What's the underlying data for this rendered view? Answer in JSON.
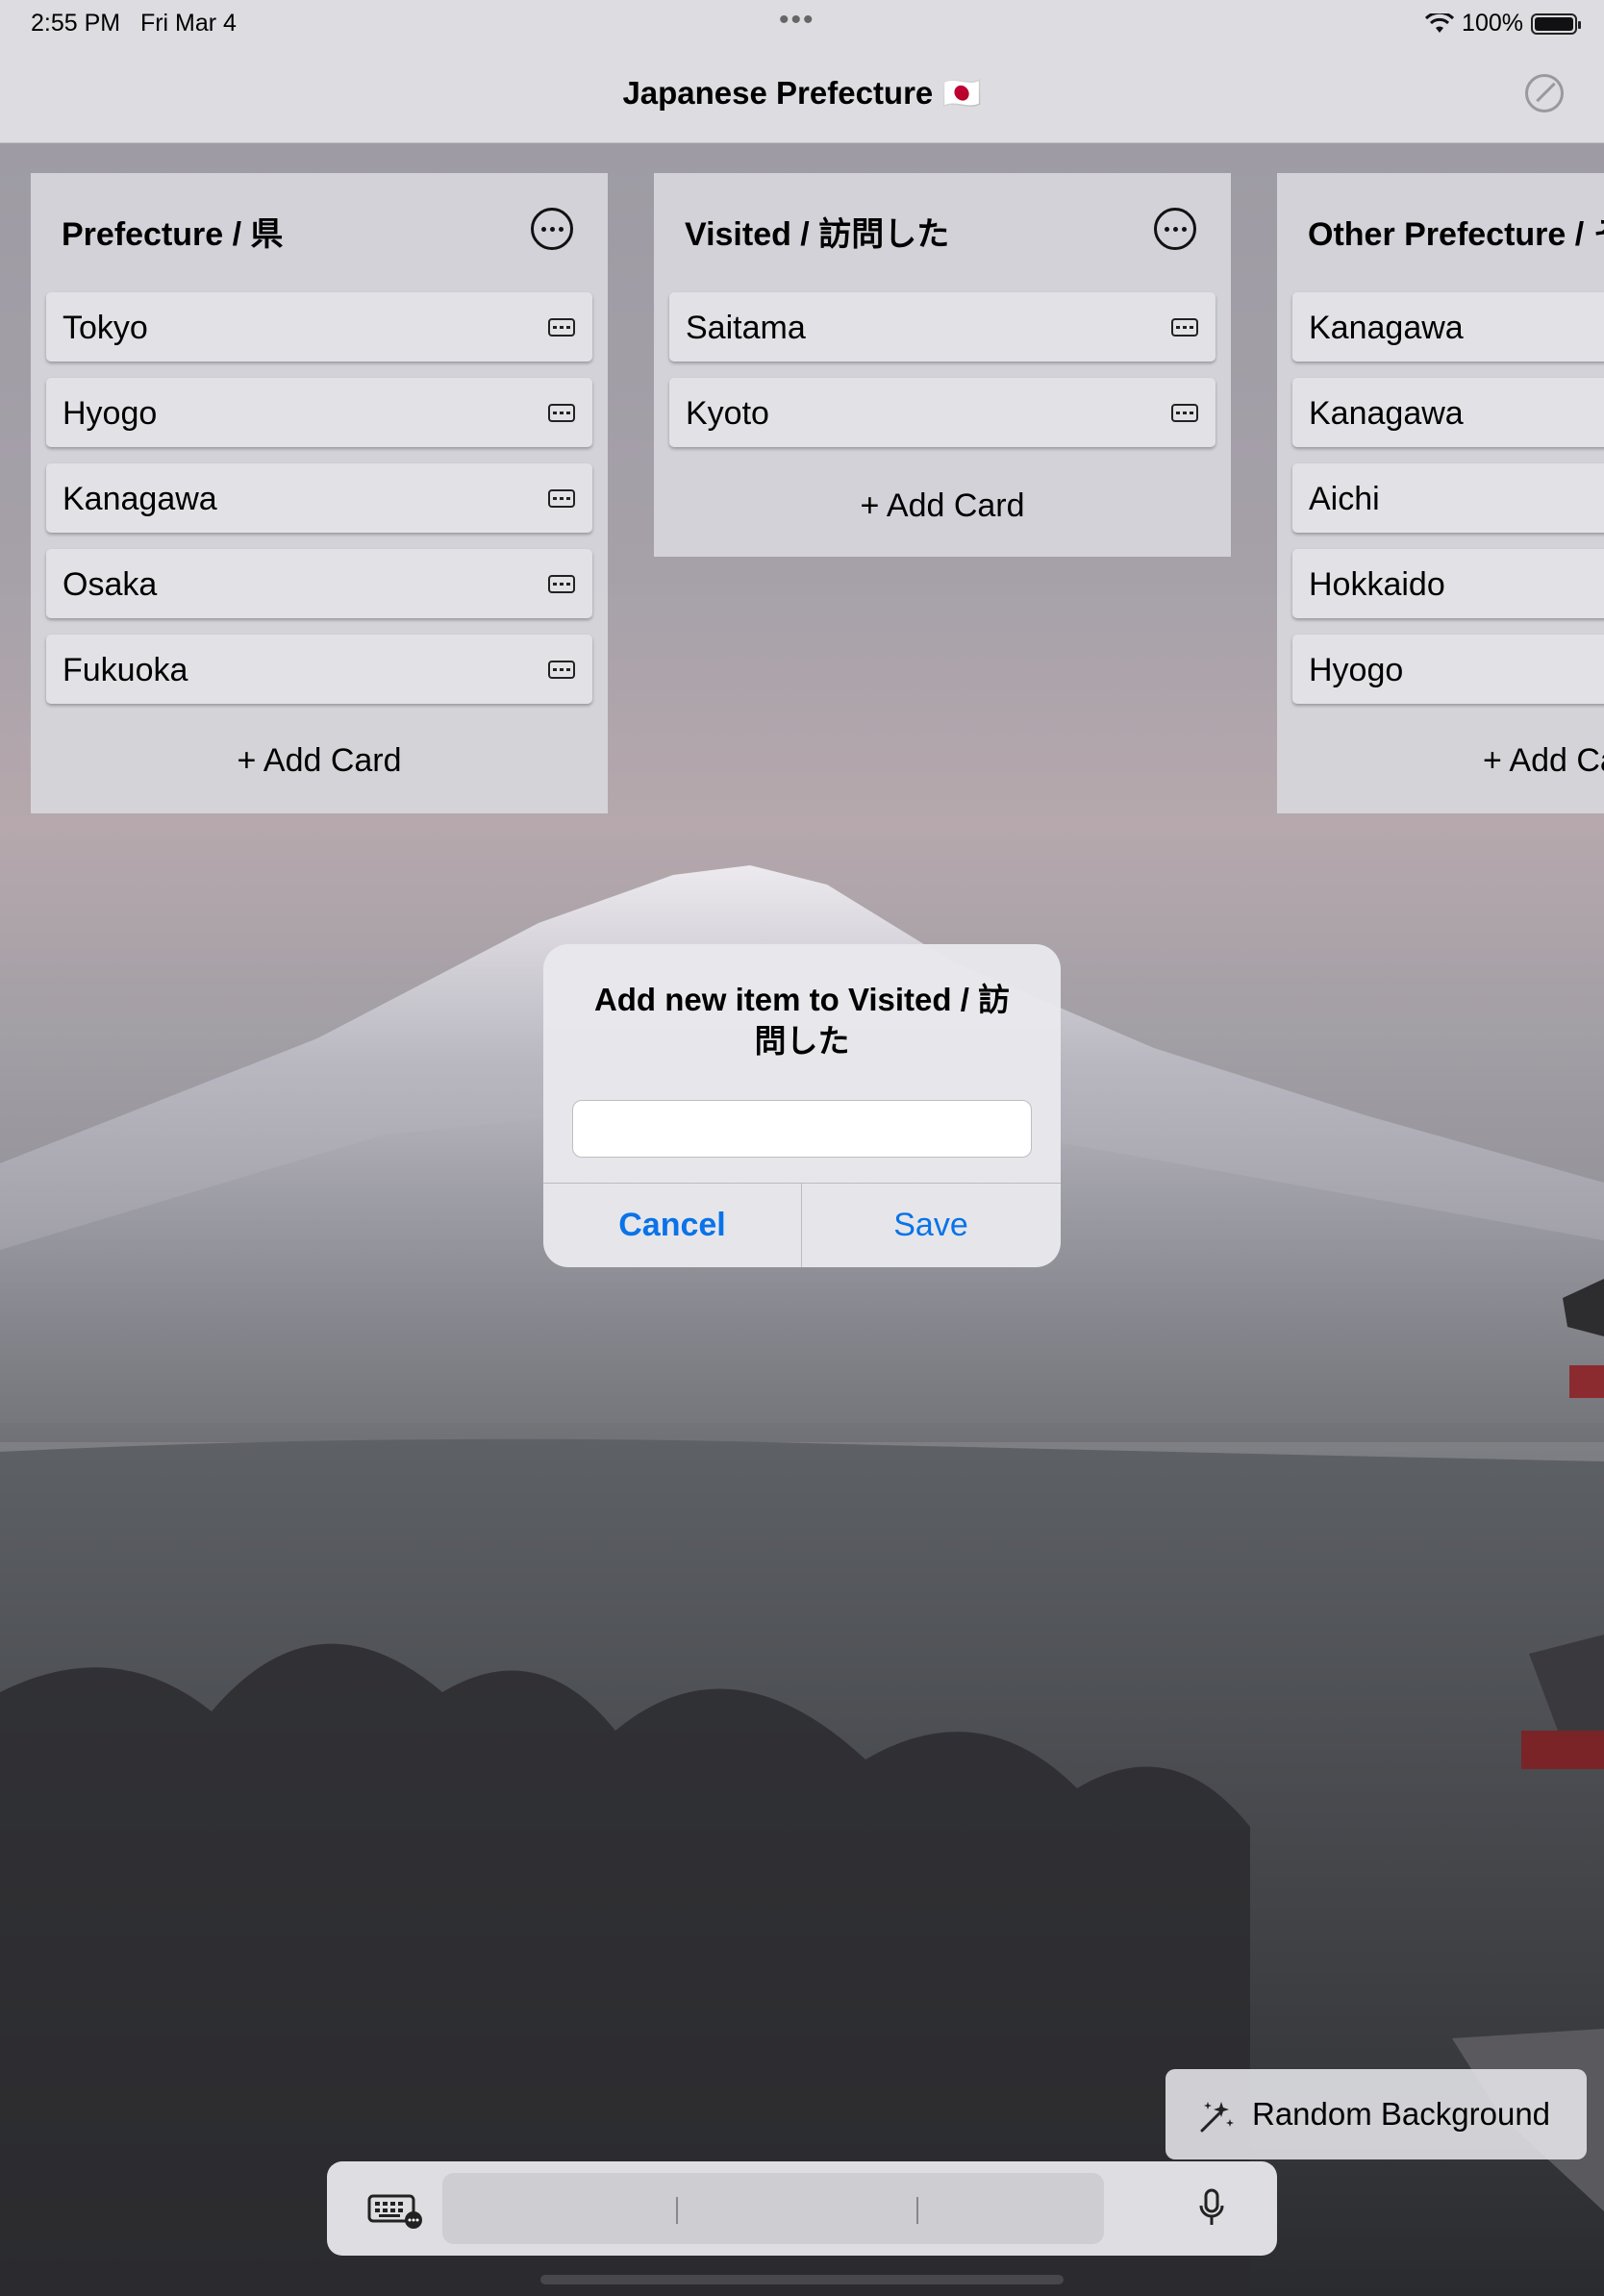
{
  "status_bar": {
    "time": "2:55 PM",
    "date": "Fri Mar 4",
    "battery": "100%"
  },
  "nav": {
    "title": "Japanese Prefecture 🇯🇵"
  },
  "columns": [
    {
      "title": "Prefecture / 県",
      "cards": [
        "Tokyo",
        "Hyogo",
        "Kanagawa",
        "Osaka",
        "Fukuoka"
      ],
      "add_label": "+ Add Card"
    },
    {
      "title": "Visited / 訪問した",
      "cards": [
        "Saitama",
        "Kyoto"
      ],
      "add_label": "+ Add Card"
    },
    {
      "title": "Other Prefecture / そ",
      "cards": [
        "Kanagawa",
        "Kanagawa",
        "Aichi",
        "Hokkaido",
        "Hyogo"
      ],
      "add_label": "+ Add Ca"
    }
  ],
  "alert": {
    "title": "Add new item to Visited / 訪問した",
    "input_value": "",
    "cancel_label": "Cancel",
    "save_label": "Save"
  },
  "random_background": {
    "label": "Random Background"
  },
  "colors": {
    "accent": "#0a73e8",
    "column_bg": "#d6d6db",
    "card_bg": "#e2e2e6"
  }
}
